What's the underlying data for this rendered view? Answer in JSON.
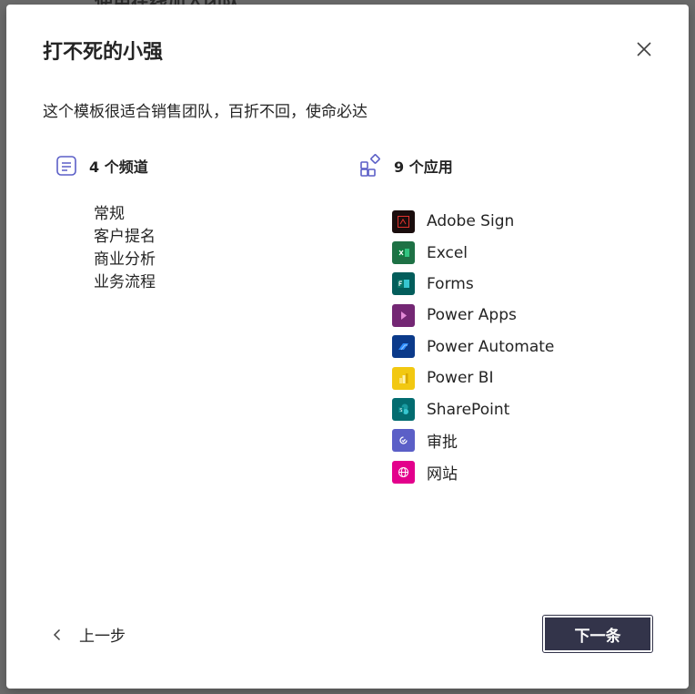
{
  "background": {
    "peek_text": "使用在线加入团队"
  },
  "dialog": {
    "title": "打不死的小强",
    "subtitle": "这个模板很适合销售团队，百折不回，使命必达",
    "close_icon": "close-icon"
  },
  "channels": {
    "heading": "4 个频道",
    "icon": "channel-list-icon",
    "items": [
      "常规",
      "客户提名",
      "商业分析",
      "业务流程"
    ]
  },
  "apps": {
    "heading": "9 个应用",
    "icon": "apps-grid-icon",
    "items": [
      {
        "label": "Adobe Sign",
        "icon": "adobe-sign-icon",
        "color": "#1a0d0d"
      },
      {
        "label": "Excel",
        "icon": "excel-icon",
        "color": "#1e7145"
      },
      {
        "label": "Forms",
        "icon": "forms-icon",
        "color": "#035d5b"
      },
      {
        "label": "Power Apps",
        "icon": "power-apps-icon",
        "color": "#742774"
      },
      {
        "label": "Power Automate",
        "icon": "power-automate-icon",
        "color": "#0b3a8a"
      },
      {
        "label": "Power BI",
        "icon": "power-bi-icon",
        "color": "#f2c811"
      },
      {
        "label": "SharePoint",
        "icon": "sharepoint-icon",
        "color": "#036c70"
      },
      {
        "label": "审批",
        "icon": "approvals-icon",
        "color": "#5b5fc7"
      },
      {
        "label": "网站",
        "icon": "website-icon",
        "color": "#e3008c"
      }
    ]
  },
  "footer": {
    "back_label": "上一步",
    "next_label": "下一条"
  }
}
